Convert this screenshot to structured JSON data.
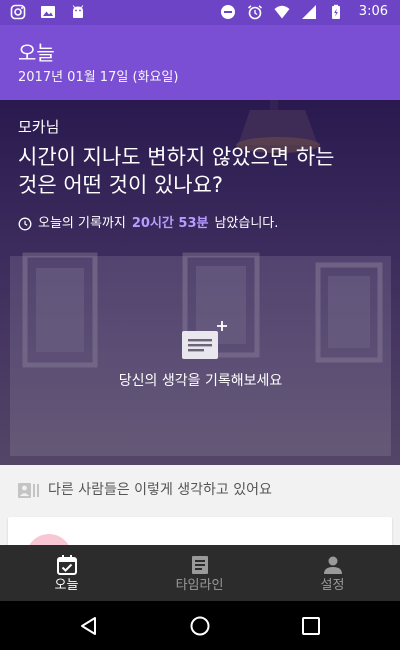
{
  "status_bar": {
    "time": "3:06",
    "left_icons": [
      "instagram-icon",
      "image-icon",
      "android-icon"
    ],
    "right_icons": [
      "minus-circle-icon",
      "alarm-icon",
      "wifi-icon",
      "signal-icon",
      "battery-charging-icon"
    ]
  },
  "app_bar": {
    "title": "오늘",
    "date": "2017년 01월 17일 (화요일)",
    "color": "#7a4fd4"
  },
  "hero": {
    "user_name": "모카님",
    "question_line1": "시간이 지나도 변하지 않았으면 하는",
    "question_line2": "것은 어떤 것이 있나요?",
    "timer_prefix": "오늘의 기록까지",
    "timer_remaining": "20시간 53분",
    "timer_suffix": "남았습니다.",
    "highlight_color": "#b79cff",
    "write_prompt": "당신의 생각을 기록해보세요"
  },
  "others": {
    "header": "다른 사람들은 이렇게 생각하고 있어요"
  },
  "bottom_nav": {
    "items": [
      {
        "label": "오늘",
        "icon": "calendar-check-icon",
        "active": true
      },
      {
        "label": "타임라인",
        "icon": "timeline-icon",
        "active": false
      },
      {
        "label": "설정",
        "icon": "person-icon",
        "active": false
      }
    ]
  },
  "system_nav": {
    "icons": [
      "back-icon",
      "home-icon",
      "recents-icon"
    ]
  }
}
